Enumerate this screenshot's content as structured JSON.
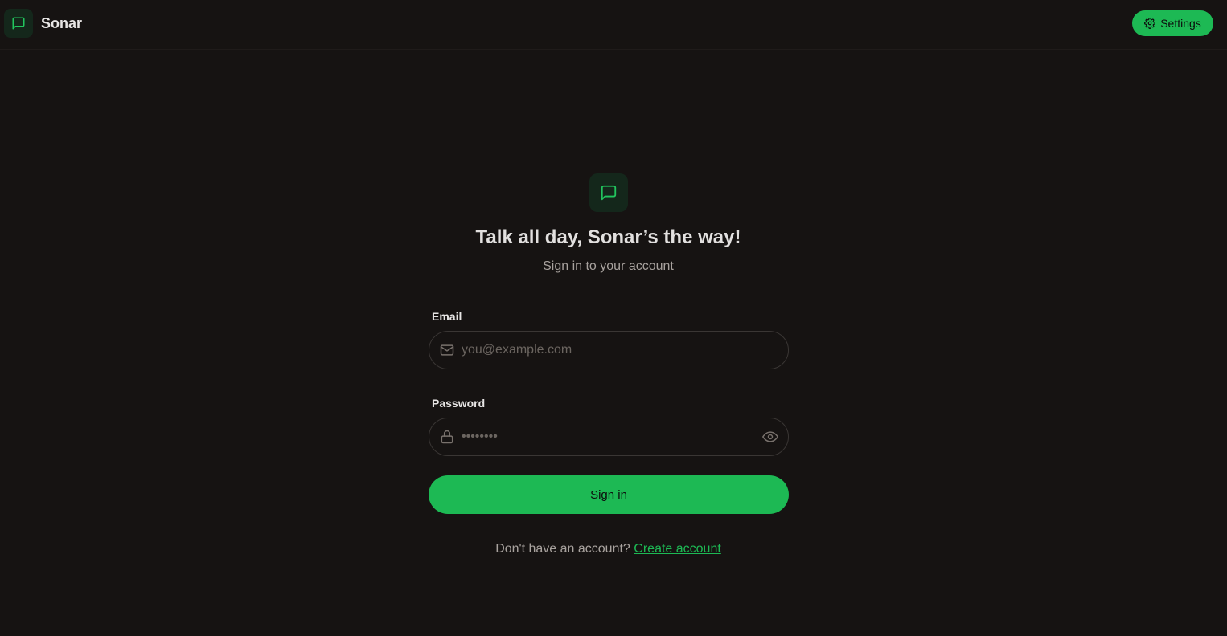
{
  "app": {
    "name": "Sonar"
  },
  "header": {
    "settings_label": "Settings"
  },
  "colors": {
    "accent": "#1db954",
    "background": "#161312",
    "badge": "#14271b"
  },
  "login": {
    "title": "Talk all day, Sonar’s the way!",
    "subtitle": "Sign in to your account",
    "email": {
      "label": "Email",
      "placeholder": "you@example.com",
      "value": ""
    },
    "password": {
      "label": "Password",
      "placeholder": "••••••••",
      "value": ""
    },
    "submit_label": "Sign in",
    "footer_prompt": "Don't have an account?",
    "footer_link": "Create account"
  },
  "icons": {
    "brand": "message-square-icon",
    "settings": "gear-icon",
    "email": "mail-icon",
    "password": "lock-icon",
    "toggle": "eye-icon"
  }
}
